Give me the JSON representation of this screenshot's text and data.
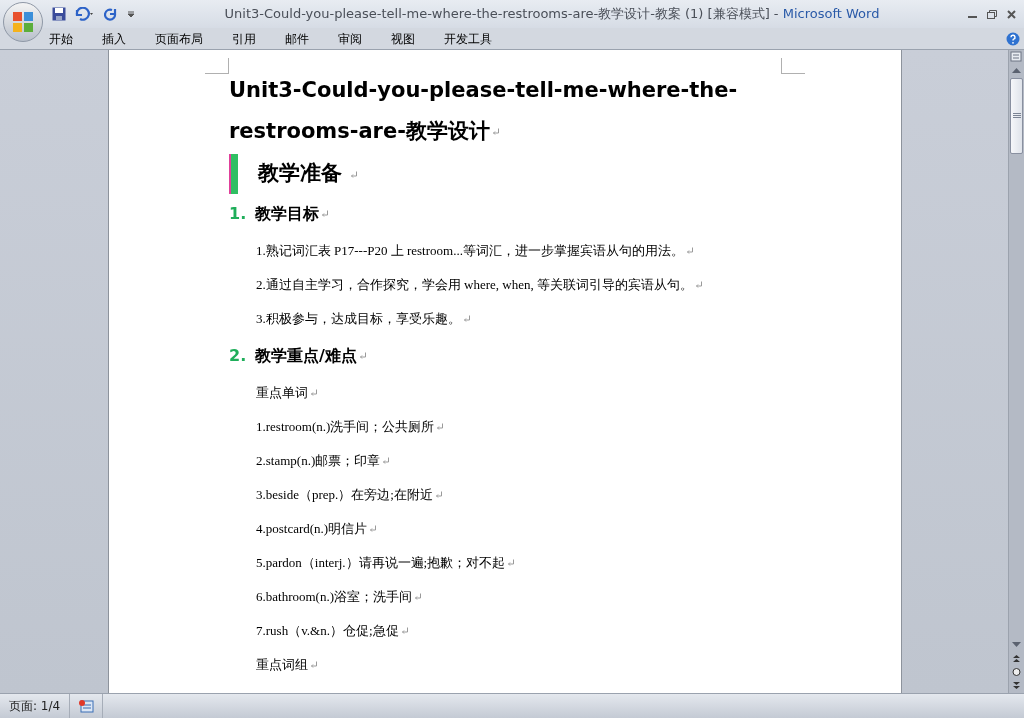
{
  "window": {
    "title": "Unit3-Could-you-please-tell-me-where-the-restrooms-are-教学设计-教案 (1) [兼容模式]",
    "separator": " - ",
    "app_name": "Microsoft Word"
  },
  "ribbon_tabs": [
    "开始",
    "插入",
    "页面布局",
    "引用",
    "邮件",
    "审阅",
    "视图",
    "开发工具"
  ],
  "document": {
    "title_lines": [
      "Unit3-Could-you-please-tell-me-where-the-",
      "restrooms-are-教学设计"
    ],
    "sections": [
      {
        "kind": "banner",
        "heading": "教学准备"
      },
      {
        "kind": "numbered",
        "number": "1.",
        "heading": "教学目标",
        "paragraphs": [
          "1.熟记词汇表 P17---P20 上 restroom...等词汇，进一步掌握宾语从句的用法。",
          "2.通过自主学习，合作探究，学会用 where, when, 等关联词引导的宾语从句。",
          "3.积极参与，达成目标，享受乐趣。"
        ]
      },
      {
        "kind": "numbered",
        "number": "2.",
        "heading": "教学重点/难点",
        "paragraphs": [
          "重点单词",
          "1.restroom(n.)洗手间；公共厕所",
          "2.stamp(n.)邮票；印章",
          "3.beside（prep.）在旁边;在附近",
          "4.postcard(n.)明信片",
          "5.pardon（interj.）请再说一遍;抱歉；对不起",
          "6.bathroom(n.)浴室；洗手间",
          "7.rush（v.&n.）仓促;急促",
          "重点词组"
        ]
      }
    ]
  },
  "status_bar": {
    "page": "页面: 1/4"
  }
}
